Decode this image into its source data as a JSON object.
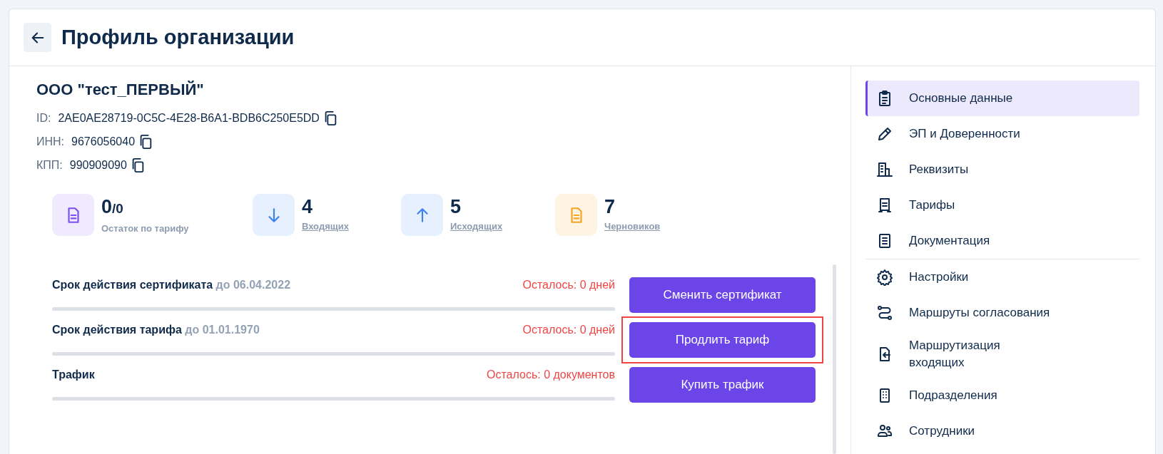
{
  "header": {
    "title": "Профиль организации"
  },
  "organization": {
    "name": "ООО \"тест_ПЕРВЫЙ\"",
    "fields": [
      {
        "label": "ID:",
        "value": "2AE0AE28719-0C5C-4E28-B6A1-BDB6C250E5DD"
      },
      {
        "label": "ИНН:",
        "value": "9676056040"
      },
      {
        "label": "КПП:",
        "value": "990909090"
      }
    ]
  },
  "stats": [
    {
      "value": "0",
      "suffix": "/0",
      "label": "Остаток по тарифу",
      "link": false,
      "color": "#7b4ff0"
    },
    {
      "value": "4",
      "label": "Входящих",
      "link": true,
      "color": "#3b82f6"
    },
    {
      "value": "5",
      "label": "Исходящих",
      "link": true,
      "color": "#3b82f6"
    },
    {
      "value": "7",
      "label": "Черновиков",
      "link": true,
      "color": "#f5a524"
    }
  ],
  "limits": [
    {
      "title": "Срок действия сертификата",
      "date": "до 06.04.2022",
      "remaining": "Осталось: 0 дней",
      "button": "Сменить сертификат",
      "highlighted": false
    },
    {
      "title": "Срок действия тарифа",
      "date": "до 01.01.1970",
      "remaining": "Осталось: 0 дней",
      "button": "Продлить тариф",
      "highlighted": true
    },
    {
      "title": "Трафик",
      "remaining": "Осталось: 0 документов",
      "button": "Купить трафик",
      "highlighted": false
    }
  ],
  "sidebar": {
    "groups": [
      {
        "items": [
          {
            "label": "Основные данные",
            "selected": true
          },
          {
            "label": "ЭП и Доверенности",
            "selected": false
          },
          {
            "label": "Реквизиты",
            "selected": false
          },
          {
            "label": "Тарифы",
            "selected": false
          },
          {
            "label": "Документация",
            "selected": false
          }
        ]
      },
      {
        "items": [
          {
            "label": "Настройки",
            "selected": false
          },
          {
            "label": "Маршруты согласования",
            "selected": false
          },
          {
            "label": "Маршрутизация входящих",
            "selected": false
          },
          {
            "label": "Подразделения",
            "selected": false
          },
          {
            "label": "Сотрудники",
            "selected": false
          }
        ]
      }
    ]
  }
}
